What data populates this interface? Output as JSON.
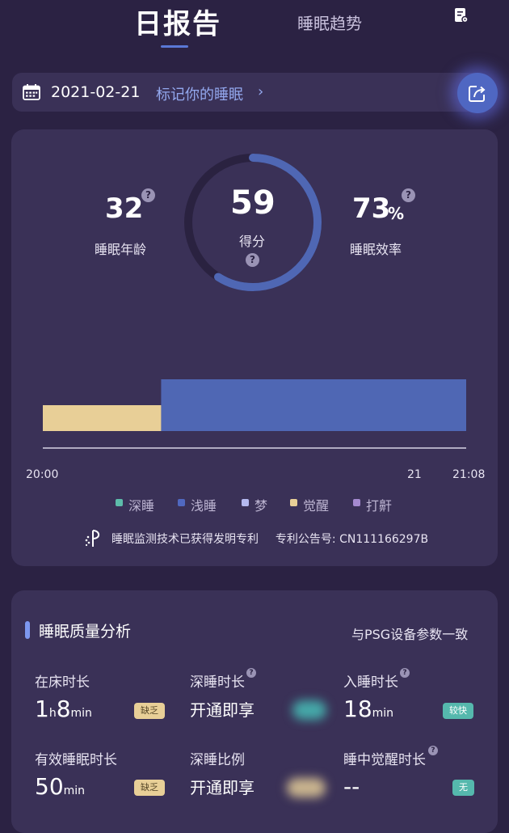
{
  "tabs": {
    "active": "日报告",
    "inactive": "睡眠趋势"
  },
  "date_bar": {
    "date": "2021-02-21",
    "mark_sleep": "标记你的睡眠",
    "chevron": "›"
  },
  "summary": {
    "sleep_age": {
      "value": "32",
      "label": "睡眠年龄"
    },
    "score": {
      "value": "59",
      "label": "得分",
      "fraction": 0.59
    },
    "efficiency": {
      "value": "73",
      "unit": "%",
      "label": "睡眠效率"
    },
    "help": "?"
  },
  "chart_data": {
    "type": "bar",
    "x_ticks": [
      "20:00",
      "21",
      "21:08"
    ],
    "segments": [
      {
        "stage": "觉醒",
        "start": "20:00",
        "end": "20:19",
        "color": "#e8cf97"
      },
      {
        "stage": "浅睡",
        "start": "20:19",
        "end": "21:08",
        "color": "#4f67b4"
      }
    ],
    "legend": [
      {
        "label": "深睡",
        "color": "#5dbcaa"
      },
      {
        "label": "浅睡",
        "color": "#5068c0"
      },
      {
        "label": "梦",
        "color": "#b5b9f0"
      },
      {
        "label": "觉醒",
        "color": "#e8cf97"
      },
      {
        "label": "打鼾",
        "color": "#a58ad0"
      }
    ]
  },
  "patent": {
    "text": "睡眠监测技术已获得发明专利",
    "number": "专利公告号: CN111166297B"
  },
  "analysis": {
    "title": "睡眠质量分析",
    "psg_note": "与PSG设备参数一致",
    "items": [
      {
        "label": "在床时长",
        "value_h": "1",
        "unit_h": "h",
        "value_m": "8",
        "unit_m": "min",
        "badge": "缺乏"
      },
      {
        "label": "深睡时长",
        "upsell": "开通即享"
      },
      {
        "label": "入睡时长",
        "value": "18",
        "unit": "min",
        "badge": "较快"
      },
      {
        "label": "有效睡眠时长",
        "value": "50",
        "unit": "min",
        "badge": "缺乏"
      },
      {
        "label": "深睡比例",
        "upsell": "开通即享"
      },
      {
        "label": "睡中觉醒时长",
        "value": "--",
        "badge": "无"
      }
    ]
  }
}
